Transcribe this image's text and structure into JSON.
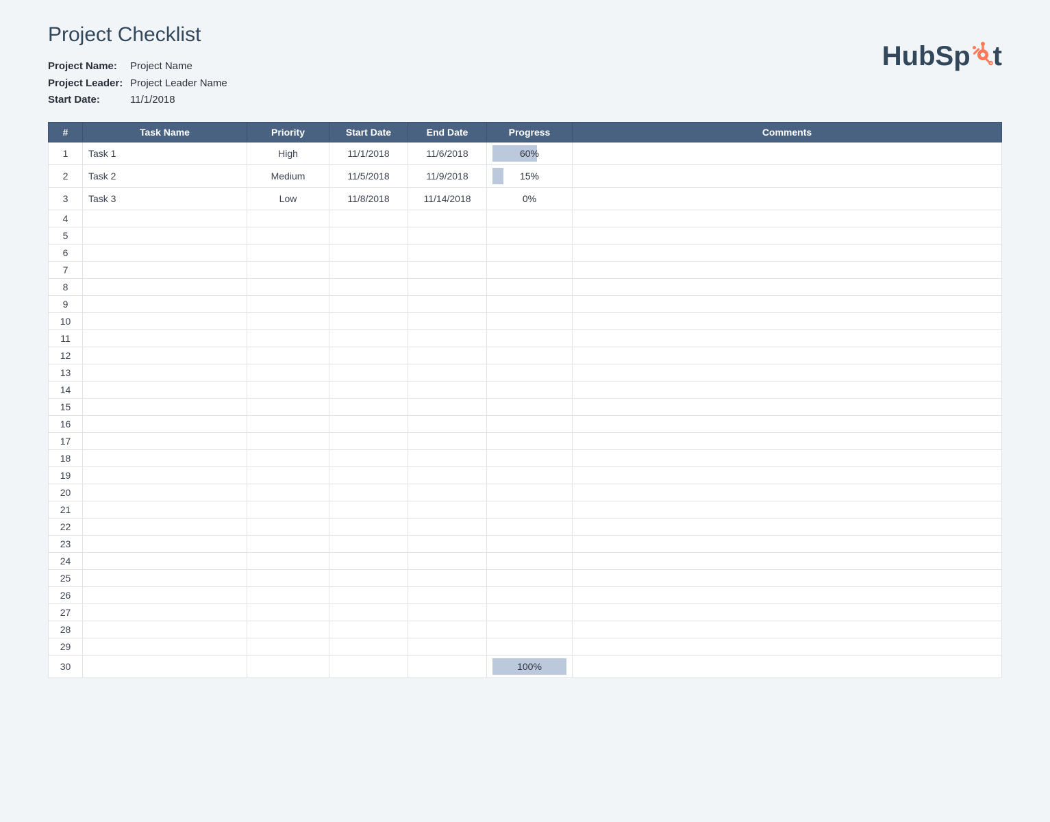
{
  "title": "Project Checklist",
  "meta": {
    "project_name_label": "Project Name:",
    "project_name_value": "Project Name",
    "project_leader_label": "Project Leader:",
    "project_leader_value": "Project Leader Name",
    "start_date_label": "Start Date:",
    "start_date_value": "11/1/2018"
  },
  "logo": {
    "text_left": "HubSp",
    "text_right": "t",
    "brand_color": "#ff7a59"
  },
  "columns": {
    "num": "#",
    "task": "Task Name",
    "priority": "Priority",
    "start": "Start Date",
    "end": "End Date",
    "progress": "Progress",
    "comments": "Comments"
  },
  "priority_colors": {
    "High": "#d94c63",
    "Medium": "#f5a167",
    "Low": "#41c6a0"
  },
  "rows": [
    {
      "num": "1",
      "task": "Task 1",
      "priority": "High",
      "start": "11/1/2018",
      "end": "11/6/2018",
      "progress": "60%",
      "progress_pct": 60,
      "comments": ""
    },
    {
      "num": "2",
      "task": "Task 2",
      "priority": "Medium",
      "start": "11/5/2018",
      "end": "11/9/2018",
      "progress": "15%",
      "progress_pct": 15,
      "comments": ""
    },
    {
      "num": "3",
      "task": "Task 3",
      "priority": "Low",
      "start": "11/8/2018",
      "end": "11/14/2018",
      "progress": "0%",
      "progress_pct": 0,
      "comments": ""
    },
    {
      "num": "4",
      "task": "",
      "priority": "",
      "start": "",
      "end": "",
      "progress": "",
      "progress_pct": null,
      "comments": ""
    },
    {
      "num": "5",
      "task": "",
      "priority": "",
      "start": "",
      "end": "",
      "progress": "",
      "progress_pct": null,
      "comments": ""
    },
    {
      "num": "6",
      "task": "",
      "priority": "",
      "start": "",
      "end": "",
      "progress": "",
      "progress_pct": null,
      "comments": ""
    },
    {
      "num": "7",
      "task": "",
      "priority": "",
      "start": "",
      "end": "",
      "progress": "",
      "progress_pct": null,
      "comments": ""
    },
    {
      "num": "8",
      "task": "",
      "priority": "",
      "start": "",
      "end": "",
      "progress": "",
      "progress_pct": null,
      "comments": ""
    },
    {
      "num": "9",
      "task": "",
      "priority": "",
      "start": "",
      "end": "",
      "progress": "",
      "progress_pct": null,
      "comments": ""
    },
    {
      "num": "10",
      "task": "",
      "priority": "",
      "start": "",
      "end": "",
      "progress": "",
      "progress_pct": null,
      "comments": ""
    },
    {
      "num": "11",
      "task": "",
      "priority": "",
      "start": "",
      "end": "",
      "progress": "",
      "progress_pct": null,
      "comments": ""
    },
    {
      "num": "12",
      "task": "",
      "priority": "",
      "start": "",
      "end": "",
      "progress": "",
      "progress_pct": null,
      "comments": ""
    },
    {
      "num": "13",
      "task": "",
      "priority": "",
      "start": "",
      "end": "",
      "progress": "",
      "progress_pct": null,
      "comments": ""
    },
    {
      "num": "14",
      "task": "",
      "priority": "",
      "start": "",
      "end": "",
      "progress": "",
      "progress_pct": null,
      "comments": ""
    },
    {
      "num": "15",
      "task": "",
      "priority": "",
      "start": "",
      "end": "",
      "progress": "",
      "progress_pct": null,
      "comments": ""
    },
    {
      "num": "16",
      "task": "",
      "priority": "",
      "start": "",
      "end": "",
      "progress": "",
      "progress_pct": null,
      "comments": ""
    },
    {
      "num": "17",
      "task": "",
      "priority": "",
      "start": "",
      "end": "",
      "progress": "",
      "progress_pct": null,
      "comments": ""
    },
    {
      "num": "18",
      "task": "",
      "priority": "",
      "start": "",
      "end": "",
      "progress": "",
      "progress_pct": null,
      "comments": ""
    },
    {
      "num": "19",
      "task": "",
      "priority": "",
      "start": "",
      "end": "",
      "progress": "",
      "progress_pct": null,
      "comments": ""
    },
    {
      "num": "20",
      "task": "",
      "priority": "",
      "start": "",
      "end": "",
      "progress": "",
      "progress_pct": null,
      "comments": ""
    },
    {
      "num": "21",
      "task": "",
      "priority": "",
      "start": "",
      "end": "",
      "progress": "",
      "progress_pct": null,
      "comments": ""
    },
    {
      "num": "22",
      "task": "",
      "priority": "",
      "start": "",
      "end": "",
      "progress": "",
      "progress_pct": null,
      "comments": ""
    },
    {
      "num": "23",
      "task": "",
      "priority": "",
      "start": "",
      "end": "",
      "progress": "",
      "progress_pct": null,
      "comments": ""
    },
    {
      "num": "24",
      "task": "",
      "priority": "",
      "start": "",
      "end": "",
      "progress": "",
      "progress_pct": null,
      "comments": ""
    },
    {
      "num": "25",
      "task": "",
      "priority": "",
      "start": "",
      "end": "",
      "progress": "",
      "progress_pct": null,
      "comments": ""
    },
    {
      "num": "26",
      "task": "",
      "priority": "",
      "start": "",
      "end": "",
      "progress": "",
      "progress_pct": null,
      "comments": ""
    },
    {
      "num": "27",
      "task": "",
      "priority": "",
      "start": "",
      "end": "",
      "progress": "",
      "progress_pct": null,
      "comments": ""
    },
    {
      "num": "28",
      "task": "",
      "priority": "",
      "start": "",
      "end": "",
      "progress": "",
      "progress_pct": null,
      "comments": ""
    },
    {
      "num": "29",
      "task": "",
      "priority": "",
      "start": "",
      "end": "",
      "progress": "",
      "progress_pct": null,
      "comments": ""
    },
    {
      "num": "30",
      "task": "",
      "priority": "",
      "start": "",
      "end": "",
      "progress": "100%",
      "progress_pct": 100,
      "comments": ""
    }
  ]
}
